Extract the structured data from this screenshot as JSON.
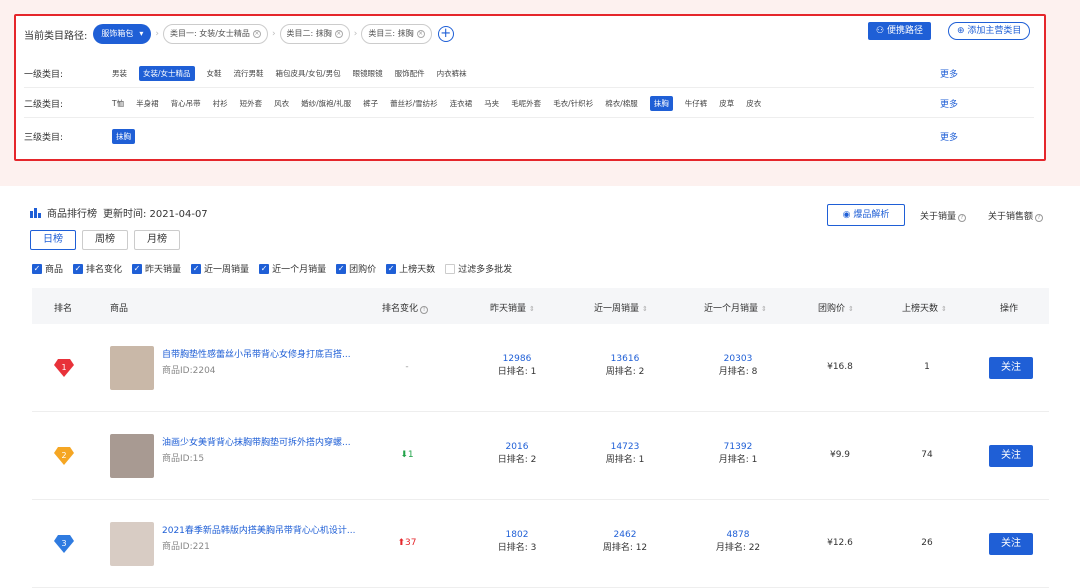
{
  "path": {
    "label": "当前类目路径:",
    "root_chip": "服饰箱包",
    "chips": [
      "类目一: 女装/女士精品",
      "类目二: 抹胸",
      "类目三: 抹胸"
    ],
    "shortcut_button": "便携路径",
    "add_button": "添加主营类目"
  },
  "categories": [
    {
      "label": "一级类目:",
      "items": [
        "男装",
        "女装/女士精品",
        "女鞋",
        "流行男鞋",
        "箱包皮具/女包/男包",
        "眼镜眼镜",
        "服饰配件",
        "内衣裤袜"
      ],
      "selected": 1
    },
    {
      "label": "二级类目:",
      "items": [
        "T恤",
        "半身裙",
        "背心吊带",
        "衬衫",
        "短外套",
        "风衣",
        "婚纱/旗袍/礼服",
        "裤子",
        "蕾丝衫/雪纺衫",
        "连衣裙",
        "马夹",
        "毛呢外套",
        "毛衣/针织衫",
        "棉衣/棉服",
        "抹胸",
        "牛仔裤",
        "皮草",
        "皮衣"
      ],
      "selected": 14
    },
    {
      "label": "三级类目:",
      "items": [
        "抹胸"
      ],
      "selected": 0
    }
  ],
  "more_label": "更多",
  "ranking": {
    "title": "商品排行榜",
    "update_time": "更新时间: 2021-04-07",
    "analysis_button": "爆品解析",
    "about_sales": "关于销量",
    "about_revenue": "关于销售额",
    "tabs": [
      "日榜",
      "周榜",
      "月榜"
    ],
    "filters": [
      {
        "label": "商品",
        "checked": true
      },
      {
        "label": "排名变化",
        "checked": true
      },
      {
        "label": "昨天销量",
        "checked": true
      },
      {
        "label": "近一周销量",
        "checked": true
      },
      {
        "label": "近一个月销量",
        "checked": true
      },
      {
        "label": "团购价",
        "checked": true
      },
      {
        "label": "上榜天数",
        "checked": true
      },
      {
        "label": "过滤多多批发",
        "checked": false
      }
    ],
    "columns": [
      "排名",
      "商品",
      "排名变化",
      "昨天销量",
      "近一周销量",
      "近一个月销量",
      "团购价",
      "上榜天数",
      "操作"
    ],
    "follow_label": "关注",
    "rows": [
      {
        "rank": "1",
        "title": "自带胸垫性感蕾丝小吊带背心女修身打底百搭...",
        "pid": "商品ID:2204",
        "change": "-",
        "change_dir": "none",
        "day": "12986",
        "day_rank": "日排名: 1",
        "week": "13616",
        "week_rank": "周排名: 2",
        "month": "20303",
        "month_rank": "月排名: 8",
        "price": "¥16.8",
        "days": "1",
        "gem_color": "#e8323a"
      },
      {
        "rank": "2",
        "title": "油画少女美背背心抹胸带胸垫可拆外搭内穿螺...",
        "pid": "商品ID:15",
        "change": "1",
        "change_dir": "down",
        "day": "2016",
        "day_rank": "日排名: 2",
        "week": "14723",
        "week_rank": "周排名: 1",
        "month": "71392",
        "month_rank": "月排名: 1",
        "price": "¥9.9",
        "days": "74",
        "gem_color": "#f5a623"
      },
      {
        "rank": "3",
        "title": "2021春季新品韩版内搭美胸吊带背心心机设计...",
        "pid": "商品ID:221",
        "change": "37",
        "change_dir": "up",
        "day": "1802",
        "day_rank": "日排名: 3",
        "week": "2462",
        "week_rank": "周排名: 12",
        "month": "4878",
        "month_rank": "月排名: 22",
        "price": "¥12.6",
        "days": "26",
        "gem_color": "#2f7be0"
      }
    ]
  }
}
